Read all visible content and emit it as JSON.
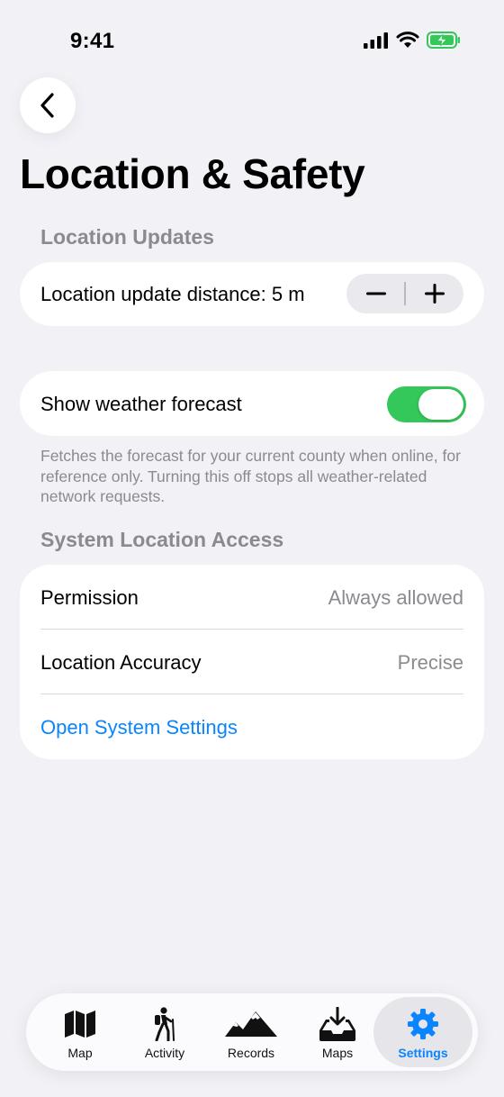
{
  "status_bar": {
    "time": "9:41"
  },
  "nav": {
    "back_icon": "chevron-left-icon"
  },
  "page": {
    "title": "Location & Safety"
  },
  "location_updates": {
    "header": "Location Updates",
    "distance_label": "Location update distance: 5 m",
    "decrement": "−",
    "increment": "+"
  },
  "weather": {
    "label": "Show weather forecast",
    "enabled": true,
    "footnote": "Fetches the forecast for your current county when online, for reference only. Turning this off stops all weather-related network requests."
  },
  "system_access": {
    "header": "System Location Access",
    "rows": [
      {
        "label": "Permission",
        "value": "Always allowed"
      },
      {
        "label": "Location Accuracy",
        "value": "Precise"
      }
    ],
    "link": "Open System Settings"
  },
  "tabs": [
    {
      "label": "Map",
      "icon": "map-icon"
    },
    {
      "label": "Activity",
      "icon": "hiker-icon"
    },
    {
      "label": "Records",
      "icon": "mountains-icon"
    },
    {
      "label": "Maps",
      "icon": "download-tray-icon"
    },
    {
      "label": "Settings",
      "icon": "gear-icon",
      "active": true
    }
  ],
  "colors": {
    "accent": "#0a84ff",
    "toggle_on": "#34c759",
    "background": "#f1f1f6"
  }
}
